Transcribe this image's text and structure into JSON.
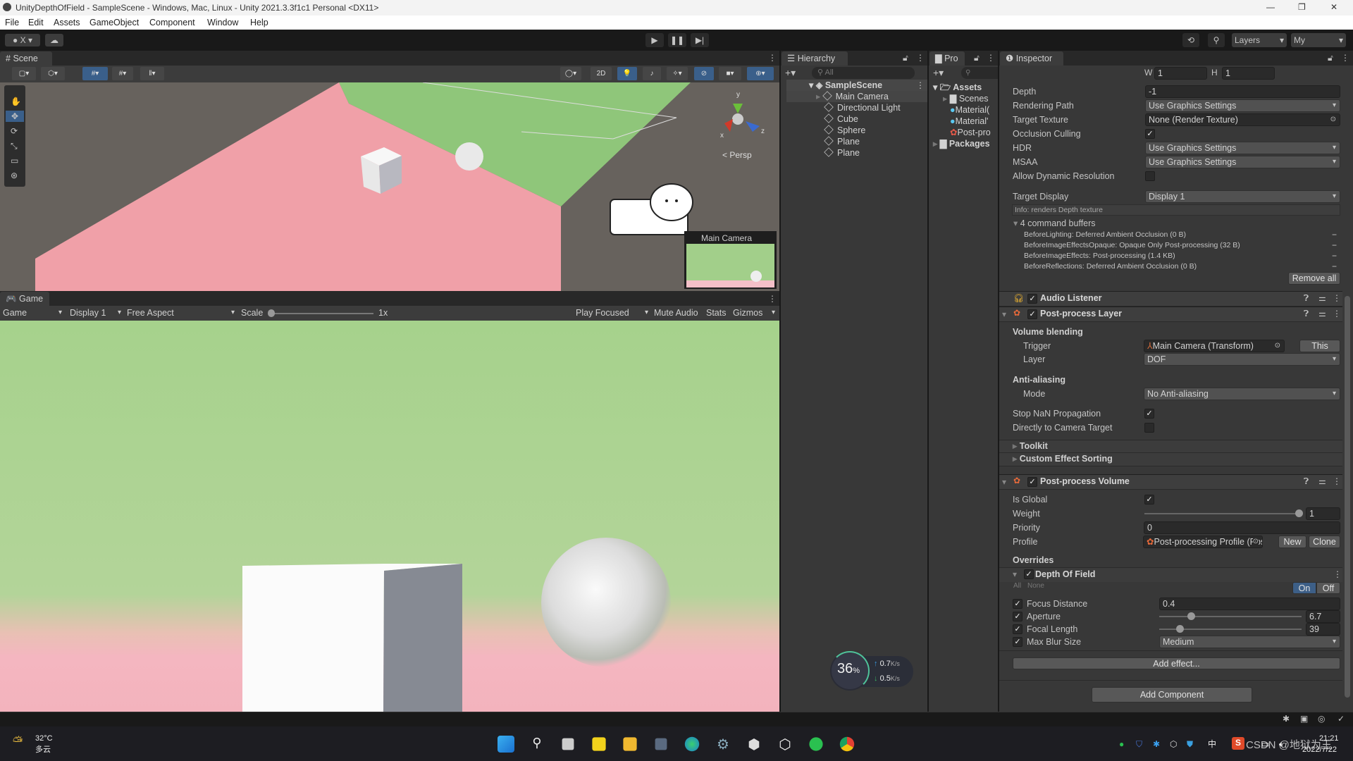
{
  "window": {
    "title": "UnityDepthOfField - SampleScene - Windows, Mac, Linux - Unity 2021.3.3f1c1 Personal <DX11>"
  },
  "menu": [
    "File",
    "Edit",
    "Assets",
    "GameObject",
    "Component",
    "Window",
    "Help"
  ],
  "toolbar": {
    "account": "X",
    "layers": "Layers",
    "layout": "My"
  },
  "scene": {
    "tab": "Scene",
    "btn_2d": "2D",
    "persp": "< Persp",
    "axis_x": "x",
    "axis_y": "y",
    "axis_z": "z",
    "camera_preview_title": "Main Camera"
  },
  "game": {
    "tab": "Game",
    "mode": "Game",
    "display": "Display 1",
    "aspect": "Free Aspect",
    "scale_label": "Scale",
    "scale_value": "1x",
    "play_focused": "Play Focused",
    "mute_audio": "Mute Audio",
    "stats": "Stats",
    "gizmos": "Gizmos"
  },
  "hierarchy": {
    "tab": "Hierarchy",
    "search_placeholder": "All",
    "scene": "SampleScene",
    "items": [
      "Main Camera",
      "Directional Light",
      "Cube",
      "Sphere",
      "Plane",
      "Plane"
    ]
  },
  "project": {
    "tab": "Pro",
    "assets": "Assets",
    "items": [
      "Scenes",
      "Material(",
      "Material'",
      "Post-pro"
    ],
    "packages": "Packages"
  },
  "inspector": {
    "tab": "Inspector",
    "w_label": "W",
    "w": "1",
    "h_label": "H",
    "h": "1",
    "depth_label": "Depth",
    "depth": "-1",
    "rendering_path_label": "Rendering Path",
    "rendering_path": "Use Graphics Settings",
    "target_texture_label": "Target Texture",
    "target_texture": "None (Render Texture)",
    "occlusion_label": "Occlusion Culling",
    "occlusion": true,
    "hdr_label": "HDR",
    "hdr": "Use Graphics Settings",
    "msaa_label": "MSAA",
    "msaa": "Use Graphics Settings",
    "dyn_res_label": "Allow Dynamic Resolution",
    "dyn_res": false,
    "target_display_label": "Target Display",
    "target_display": "Display 1",
    "info": "Info: renders Depth texture",
    "cmd_buffers_label": "4 command buffers",
    "cmd_buffers": [
      "BeforeLighting: Deferred Ambient Occlusion (0 B)",
      "BeforeImageEffectsOpaque: Opaque Only Post-processing (32 B)",
      "BeforeImageEffects: Post-processing (1.4 KB)",
      "BeforeReflections: Deferred Ambient Occlusion (0 B)"
    ],
    "remove_all": "Remove all",
    "audio_listener": "Audio Listener",
    "pp_layer": {
      "title": "Post-process Layer",
      "volume_blending": "Volume blending",
      "trigger_label": "Trigger",
      "trigger": "Main Camera (Transform)",
      "this": "This",
      "layer_label": "Layer",
      "layer": "DOF",
      "anti_aliasing": "Anti-aliasing",
      "mode_label": "Mode",
      "mode": "No Anti-aliasing",
      "stop_nan_label": "Stop NaN Propagation",
      "stop_nan": true,
      "direct_label": "Directly to Camera Target",
      "direct": false,
      "toolkit": "Toolkit",
      "custom_sorting": "Custom Effect Sorting"
    },
    "pp_volume": {
      "title": "Post-process Volume",
      "is_global_label": "Is Global",
      "is_global": true,
      "weight_label": "Weight",
      "weight": "1",
      "priority_label": "Priority",
      "priority": "0",
      "profile_label": "Profile",
      "profile": "Post-processing Profile (Pos",
      "new": "New",
      "clone": "Clone",
      "overrides": "Overrides",
      "dof": {
        "title": "Depth Of Field",
        "all": "All",
        "none": "None",
        "on": "On",
        "off": "Off",
        "focus_label": "Focus Distance",
        "focus": "0.4",
        "aperture_label": "Aperture",
        "aperture": "6.7",
        "focal_label": "Focal Length",
        "focal": "39",
        "blur_label": "Max Blur Size",
        "blur": "Medium"
      },
      "add_effect": "Add effect..."
    },
    "add_component": "Add Component"
  },
  "network": {
    "cpu": "36",
    "cpu_unit": "%",
    "up": "0.7",
    "down": "0.5",
    "rate_unit": "K/s"
  },
  "taskbar": {
    "temp": "32°C",
    "weather": "多云",
    "time": "21:21",
    "date": "2022/7/22",
    "ime": "中",
    "watermark": "CSDN @地狱为王"
  },
  "colors": {
    "accent": "#3a79bb",
    "scene_green": "#8fc67a",
    "scene_pink": "#f0a0a8",
    "game_green": "#a6d28c",
    "game_pink": "#f4b6c0"
  }
}
